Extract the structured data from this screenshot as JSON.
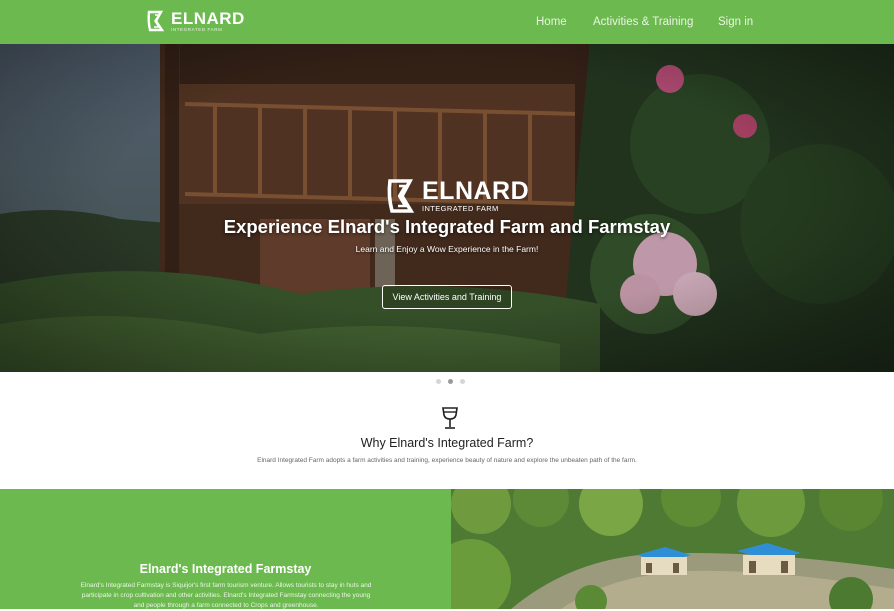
{
  "navbar": {
    "brand_name": "ELNARD",
    "brand_sub": "INTEGRATED FARM",
    "links": [
      "Home",
      "Activities & Training",
      "Sign in"
    ],
    "color": "#6cba4f"
  },
  "hero": {
    "logo_name": "ELNARD",
    "logo_sub": "INTEGRATED FARM",
    "title": "Experience Elnard's Integrated Farm and Farmstay",
    "subtitle": "Learn and Enjoy a Wow Experience in the Farm!",
    "button_label": "View Activities and Training",
    "active_slide": 2,
    "slide_count": 3
  },
  "why": {
    "icon": "wine-glass-icon",
    "title": "Why Elnard's Integrated Farm?",
    "text": "Elnard Integrated Farm adopts a farm activities and training, experience beauty of nature and explore the unbeaten path of the farm."
  },
  "farmstay": {
    "title": "Elnard's Integrated Farmstay",
    "text": "Elnard's Integrated Farmstay is Siquijor's first farm tourism venture. Allows tourists to stay in huts and participate in crop cultivation and other activities. Elnard's Integrated Farmstay connecting the young and people through a farm connected to Crops and greenhouse."
  },
  "colors": {
    "accent": "#6cba4f",
    "white": "#ffffff"
  }
}
